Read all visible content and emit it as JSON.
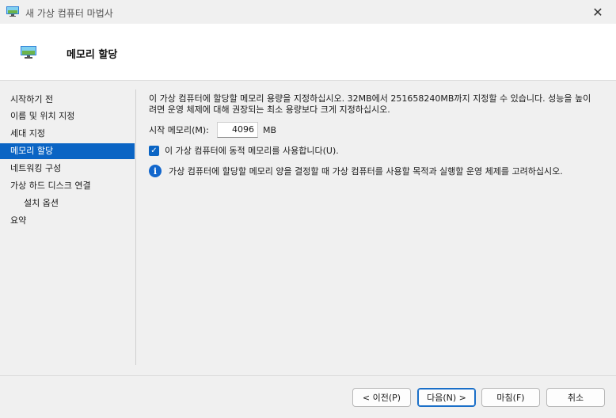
{
  "window": {
    "title": "새 가상 컴퓨터 마법사",
    "close_label": "✕"
  },
  "header": {
    "title": "메모리 할당"
  },
  "sidebar": {
    "items": [
      {
        "label": "시작하기 전",
        "active": false
      },
      {
        "label": "이름 및 위치 지정",
        "active": false
      },
      {
        "label": "세대 지정",
        "active": false
      },
      {
        "label": "메모리 할당",
        "active": true
      },
      {
        "label": "네트워킹 구성",
        "active": false
      },
      {
        "label": "가상 하드 디스크 연결",
        "active": false
      },
      {
        "label": "설치 옵션",
        "active": false
      },
      {
        "label": "요약",
        "active": false
      }
    ]
  },
  "main": {
    "description_line1": "이 가상 컴퓨터에 할당할 메모리 용량을 지정하십시오. 32MB에서 251658240MB까지 지정할 수 있습니다. 성능을 높이",
    "description_line2": "려면 운영 체제에 대해 권장되는 최소 용량보다 크게 지정하십시오.",
    "startup_memory_label": "시작 메모리(M):",
    "startup_memory_value": "4096",
    "startup_memory_unit": "MB",
    "dynamic_memory_label": "이 가상 컴퓨터에 동적 메모리를 사용합니다(U).",
    "dynamic_memory_checked": true,
    "info_text": "가상 컴퓨터에 할당할 메모리 양을 결정할 때 가상 컴퓨터를 사용할 목적과 실행할 운영 체제를 고려하십시오."
  },
  "footer": {
    "prev_label": "< 이전(P)",
    "next_label": "다음(N) >",
    "finish_label": "마침(F)",
    "cancel_label": "취소"
  },
  "colors": {
    "accent": "#0a64c4",
    "info_icon": "#1166cc"
  },
  "icons": {
    "window": "monitor-icon",
    "close": "close-icon",
    "check": "checkmark-icon",
    "info": "info-icon"
  }
}
